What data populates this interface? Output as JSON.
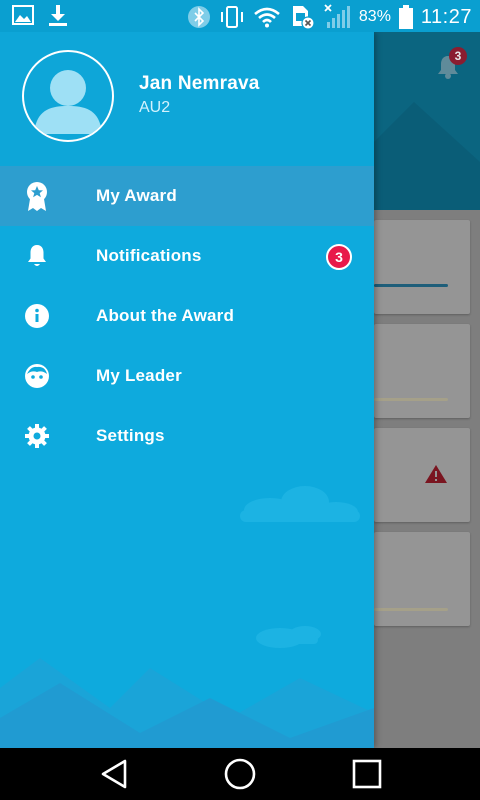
{
  "status_bar": {
    "time": "11:27",
    "battery_percent": "83%",
    "icons": [
      "image-icon",
      "download-icon",
      "bluetooth-icon",
      "vibrate-icon",
      "wifi-icon",
      "sim-card-icon",
      "signal-icon",
      "battery-icon"
    ]
  },
  "drawer": {
    "user": {
      "name": "Jan Nemrava",
      "subtitle": "AU2"
    },
    "menu": [
      {
        "label": "My Award",
        "icon": "award-icon",
        "active": true
      },
      {
        "label": "Notifications",
        "icon": "bell-icon",
        "badge": "3"
      },
      {
        "label": "About the Award",
        "icon": "info-icon"
      },
      {
        "label": "My Leader",
        "icon": "leader-face-icon"
      },
      {
        "label": "Settings",
        "icon": "gear-icon"
      }
    ]
  },
  "background_app": {
    "notification_count": "3"
  },
  "nav_bar": {
    "icons": [
      "back-icon",
      "home-icon",
      "recents-icon"
    ]
  },
  "colors": {
    "drawer": "#0eaadd",
    "active_item": "#2d9ecf",
    "badge": "#e8194a",
    "status_bar": "#0a9fd0",
    "bg_header": "#0b6580"
  }
}
